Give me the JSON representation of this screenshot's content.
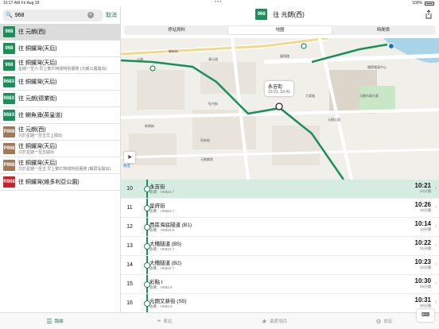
{
  "status_bar": {
    "time": "10:17 AM",
    "date": "Fri Aug 19",
    "battery": "100%"
  },
  "search": {
    "value": "968",
    "placeholder": "",
    "cancel": "取消"
  },
  "routes": [
    {
      "no": "968",
      "dest": "往 元朗(西)",
      "note": "",
      "color": "#1a8f5a"
    },
    {
      "no": "968",
      "dest": "往 銅鑼灣(天后)",
      "note": "",
      "color": "#1a8f5a"
    },
    {
      "no": "968",
      "dest": "往 銅鑼灣(天后)",
      "note": "星期一至六 早上繁忙時間特別服務 (元朗公園開出)",
      "color": "#1a8f5a"
    },
    {
      "no": "968X",
      "dest": "往 銅鑼灣(天后)",
      "note": "",
      "color": "#1a8f5a"
    },
    {
      "no": "968X",
      "dest": "往 元朗(德業街)",
      "note": "",
      "color": "#1a8f5a"
    },
    {
      "no": "968X",
      "dest": "往 鰂魚涌(英皇道)",
      "note": "",
      "color": "#1a8f5a"
    },
    {
      "no": "P968",
      "dest": "往 元朗(西)",
      "note": "只於星期一至五早上開出",
      "color": "#a0785a"
    },
    {
      "no": "P968",
      "dest": "往 銅鑼灣(天后)",
      "note": "只於星期一至五開出",
      "color": "#a0785a"
    },
    {
      "no": "P968",
      "dest": "往 銅鑼灣(天后)",
      "note": "只於星期一至五 早上繁忙時間特別服務 (朗屏站開出)",
      "color": "#a0785a"
    },
    {
      "no": "R968",
      "dest": "往 銅鑼灣(維多利亞公園)",
      "note": "",
      "color": "#c8202c"
    }
  ],
  "header": {
    "route_no": "968",
    "title": "往 元朗(西)",
    "route_color": "#1a8f5a"
  },
  "segments": [
    "停站資料",
    "地圖",
    "時間表"
  ],
  "segment_active": 1,
  "map": {
    "callout_name": "永吉街",
    "callout_times": "10:21, 10:41",
    "labels": [
      "聯新街",
      "青山道",
      "公路",
      "大棠路",
      "新興街",
      "牡丹街",
      "同安街",
      "元朗市政大廈",
      "元朗劇院",
      "國際貿易中心",
      "元朗公園",
      "鳳翔路"
    ],
    "nearby": "附近"
  },
  "stops": [
    {
      "seq": "10",
      "name": "永吉街",
      "fare": "收費：HK$24.7",
      "eta": "10:21",
      "eta_sub": "20分鐘",
      "current": true
    },
    {
      "seq": "11",
      "name": "皇府街",
      "fare": "收費：HK$24.7",
      "eta": "10:26",
      "eta_sub": "25分鐘",
      "current": false
    },
    {
      "seq": "12",
      "name": "西區海底隧道 (B1)",
      "fare": "收費：HK$15.9",
      "eta": "10:14",
      "eta_sub": "13分鐘",
      "current": false
    },
    {
      "seq": "13",
      "name": "大欖隧道 (B5)",
      "fare": "收費：HK$10.7",
      "eta": "10:22",
      "eta_sub": "21分鐘",
      "current": false
    },
    {
      "seq": "14",
      "name": "大欖隧道 (B2)",
      "fare": "收費：HK$10.7",
      "eta": "10:23",
      "eta_sub": "22分鐘",
      "current": false
    },
    {
      "seq": "15",
      "name": "彩點 I",
      "fare": "收費：HK$4.6",
      "eta": "10:30",
      "eta_sub": "29分鐘",
      "current": false
    },
    {
      "seq": "16",
      "name": "元朗又新街 (S5)",
      "fare": "收費：HK$4.6",
      "eta": "10:31",
      "eta_sub": "30分鐘",
      "current": false
    }
  ],
  "tabbar": [
    {
      "label": "路線",
      "icon": "list-icon"
    },
    {
      "label": "車站",
      "icon": "location-icon"
    },
    {
      "label": "最愛項目",
      "icon": "star-icon"
    },
    {
      "label": "設定",
      "icon": "gear-icon"
    }
  ],
  "tab_active": 0
}
